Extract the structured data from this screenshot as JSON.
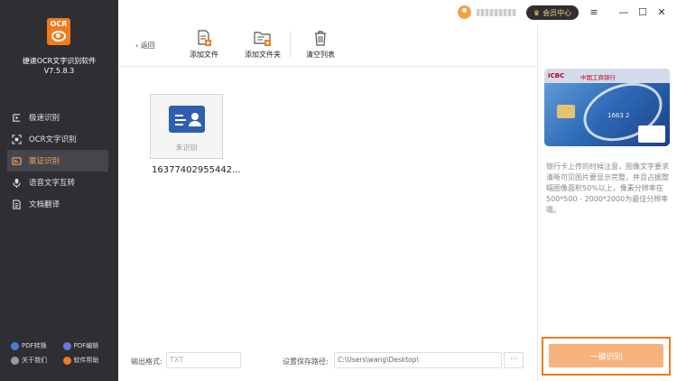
{
  "app": {
    "name": "捷速OCR文字识别软件",
    "version": "V7.5.8.3",
    "logo_text": "OCR"
  },
  "nav": [
    {
      "label": "极速识别",
      "icon": "lightning-icon"
    },
    {
      "label": "OCR文字识别",
      "icon": "scan-icon"
    },
    {
      "label": "票证识别",
      "icon": "card-icon",
      "active": true
    },
    {
      "label": "语音文字互转",
      "icon": "microphone-icon"
    },
    {
      "label": "文档翻译",
      "icon": "document-icon"
    }
  ],
  "bottom_links": [
    {
      "label": "PDF转换",
      "color": "#4b7bd6"
    },
    {
      "label": "PDF编辑",
      "color": "#6a79d9"
    },
    {
      "label": "关于我们",
      "color": "#9a9a9a"
    },
    {
      "label": "软件帮助",
      "color": "#f07c1e"
    }
  ],
  "topbar": {
    "vip_label": "会员中心"
  },
  "toolbar": {
    "back_label": "返回",
    "add_file": "添加文件",
    "add_folder": "添加文件夹",
    "clear_list": "清空列表"
  },
  "file": {
    "status": "未识别",
    "name": "16377402955442..."
  },
  "footer": {
    "output_label": "输出格式:",
    "output_value": "TXT",
    "path_label": "设置保存路径:",
    "path_value": "C:\\Users\\wang\\Desktop\\",
    "path_button": "···"
  },
  "right_panel": {
    "card_bank": "ICBC",
    "card_bank_name": "中国工商银行",
    "card_number": "1663 2",
    "hint": "银行卡上传的时候注意，图像文字要求清晰可见图片要显示完整，并且占据整幅图像面积50%以上，像素分辨率在500*500 - 2000*2000为最佳分辨率哦。",
    "ocr_button": "一键识别"
  },
  "colors": {
    "accent": "#f07c1e",
    "sidebar": "#2e2e33",
    "active_text": "#f5a25d"
  }
}
